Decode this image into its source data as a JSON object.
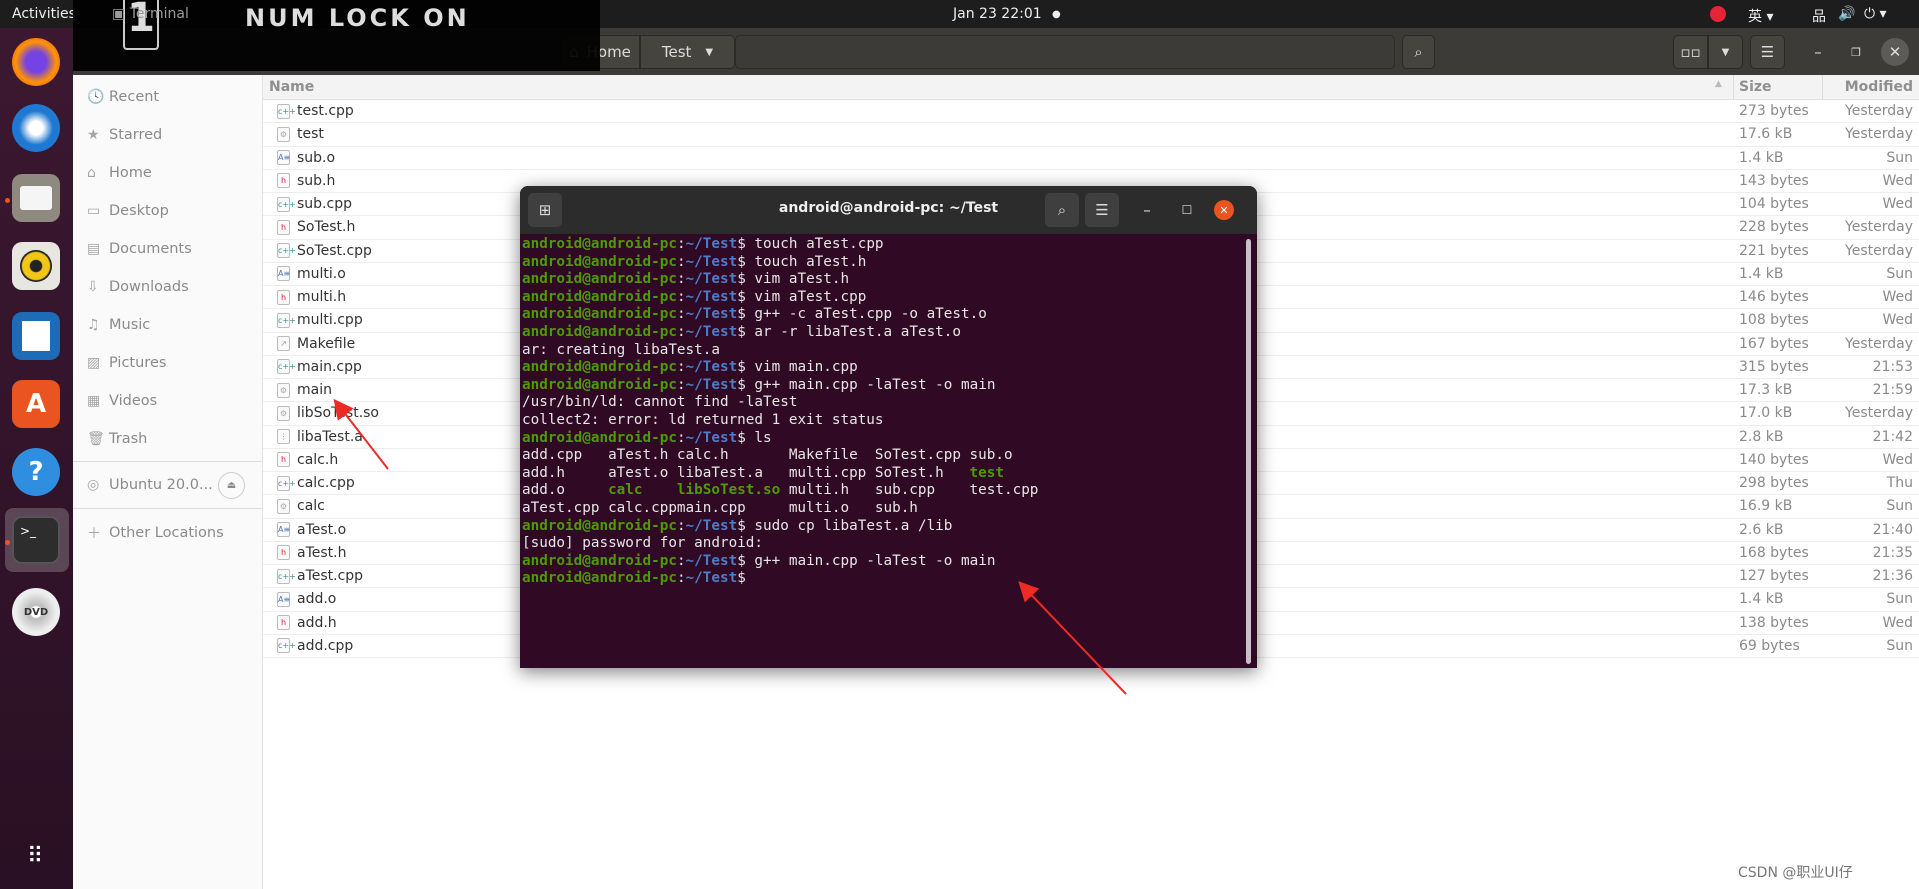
{
  "topbar": {
    "activities": "Activities",
    "app": "Terminal",
    "clock": "Jan 23  22:01",
    "input_method": "英"
  },
  "numlock": {
    "digit": "1",
    "text": "NUM LOCK ON"
  },
  "dock": {
    "items": [
      "firefox",
      "thunderbird",
      "files",
      "rhythmbox",
      "writer",
      "software",
      "help",
      "terminal",
      "dvd"
    ]
  },
  "header": {
    "path": [
      {
        "label": "Home",
        "icon": "home-icon"
      },
      {
        "label": "Test"
      }
    ]
  },
  "sidebar": {
    "items": [
      {
        "label": "Recent",
        "icon": "🕓"
      },
      {
        "label": "Starred",
        "icon": "★"
      },
      {
        "label": "Home",
        "icon": "⌂"
      },
      {
        "label": "Desktop",
        "icon": "▭"
      },
      {
        "label": "Documents",
        "icon": "▤"
      },
      {
        "label": "Downloads",
        "icon": "⇩"
      },
      {
        "label": "Music",
        "icon": "♫"
      },
      {
        "label": "Pictures",
        "icon": "▨"
      },
      {
        "label": "Videos",
        "icon": "▦"
      },
      {
        "label": "Trash",
        "icon": "🗑"
      }
    ],
    "drive": "Ubuntu 20.0...",
    "other": "Other Locations"
  },
  "columns": {
    "name": "Name",
    "size": "Size",
    "modified": "Modified"
  },
  "files": [
    {
      "name": "test.cpp",
      "type": "cpp",
      "size": "273 bytes",
      "modified": "Yesterday"
    },
    {
      "name": "test",
      "type": "exe",
      "size": "17.6 kB",
      "modified": "Yesterday"
    },
    {
      "name": "sub.o",
      "type": "obj",
      "size": "1.4 kB",
      "modified": "Sun"
    },
    {
      "name": "sub.h",
      "type": "h",
      "size": "143 bytes",
      "modified": "Wed"
    },
    {
      "name": "sub.cpp",
      "type": "cpp",
      "size": "104 bytes",
      "modified": "Wed"
    },
    {
      "name": "SoTest.h",
      "type": "h",
      "size": "228 bytes",
      "modified": "Yesterday"
    },
    {
      "name": "SoTest.cpp",
      "type": "cpp",
      "size": "221 bytes",
      "modified": "Yesterday"
    },
    {
      "name": "multi.o",
      "type": "obj",
      "size": "1.4 kB",
      "modified": "Sun"
    },
    {
      "name": "multi.h",
      "type": "h",
      "size": "146 bytes",
      "modified": "Wed"
    },
    {
      "name": "multi.cpp",
      "type": "cpp",
      "size": "108 bytes",
      "modified": "Wed"
    },
    {
      "name": "Makefile",
      "type": "make",
      "size": "167 bytes",
      "modified": "Yesterday"
    },
    {
      "name": "main.cpp",
      "type": "cpp",
      "size": "315 bytes",
      "modified": "21:53"
    },
    {
      "name": "main",
      "type": "exe",
      "size": "17.3 kB",
      "modified": "21:59"
    },
    {
      "name": "libSoTest.so",
      "type": "exe",
      "size": "17.0 kB",
      "modified": "Yesterday"
    },
    {
      "name": "libaTest.a",
      "type": "ar",
      "size": "2.8 kB",
      "modified": "21:42"
    },
    {
      "name": "calc.h",
      "type": "h",
      "size": "140 bytes",
      "modified": "Wed"
    },
    {
      "name": "calc.cpp",
      "type": "cpp",
      "size": "298 bytes",
      "modified": "Thu"
    },
    {
      "name": "calc",
      "type": "exe",
      "size": "16.9 kB",
      "modified": "Sun"
    },
    {
      "name": "aTest.o",
      "type": "obj",
      "size": "2.6 kB",
      "modified": "21:40"
    },
    {
      "name": "aTest.h",
      "type": "h",
      "size": "168 bytes",
      "modified": "21:35"
    },
    {
      "name": "aTest.cpp",
      "type": "cpp",
      "size": "127 bytes",
      "modified": "21:36"
    },
    {
      "name": "add.o",
      "type": "obj",
      "size": "1.4 kB",
      "modified": "Sun"
    },
    {
      "name": "add.h",
      "type": "h",
      "size": "138 bytes",
      "modified": "Wed"
    },
    {
      "name": "add.cpp",
      "type": "cpp",
      "size": "69 bytes",
      "modified": "Sun"
    }
  ],
  "terminal": {
    "title": "android@android-pc: ~/Test",
    "user": "android@android-pc",
    "path": "~/Test",
    "lines": [
      {
        "cmd": "touch aTest.cpp"
      },
      {
        "cmd": "touch aTest.h"
      },
      {
        "cmd": "vim aTest.h"
      },
      {
        "cmd": "vim aTest.cpp"
      },
      {
        "cmd": "g++ -c aTest.cpp -o aTest.o"
      },
      {
        "cmd": "ar -r libaTest.a aTest.o"
      },
      {
        "out": "ar: creating libaTest.a"
      },
      {
        "cmd": "vim main.cpp"
      },
      {
        "cmd": "g++ main.cpp -laTest -o main"
      },
      {
        "out": "/usr/bin/ld: cannot find -laTest"
      },
      {
        "out": "collect2: error: ld returned 1 exit status"
      },
      {
        "cmd": "ls"
      },
      {
        "ls": [
          "add.cpp",
          "aTest.h",
          "calc.h",
          "Makefile",
          "SoTest.cpp",
          "sub.o"
        ]
      },
      {
        "ls": [
          "add.h",
          "aTest.o",
          "libaTest.a",
          "multi.cpp",
          "SoTest.h",
          "test"
        ]
      },
      {
        "ls": [
          "add.o",
          "calc",
          "libSoTest.so",
          "multi.h",
          "sub.cpp",
          "test.cpp"
        ]
      },
      {
        "ls": [
          "aTest.cpp",
          "calc.cpp",
          "main.cpp",
          "multi.o",
          "sub.h",
          ""
        ]
      },
      {
        "cmd": "sudo cp libaTest.a /lib"
      },
      {
        "out": "[sudo] password for android:"
      },
      {
        "cmd": "g++ main.cpp -laTest -o main"
      },
      {
        "cmd": ""
      }
    ],
    "executables": [
      "calc",
      "libSoTest.so",
      "test"
    ]
  },
  "colors": {
    "accent": "#e95420",
    "terminal_bg": "#300a24",
    "prompt_user": "#4e9a06",
    "prompt_path": "#4f7cc6",
    "annotation_arrow": "#ee2a24"
  },
  "watermark": "CSDN @职业UI仔"
}
